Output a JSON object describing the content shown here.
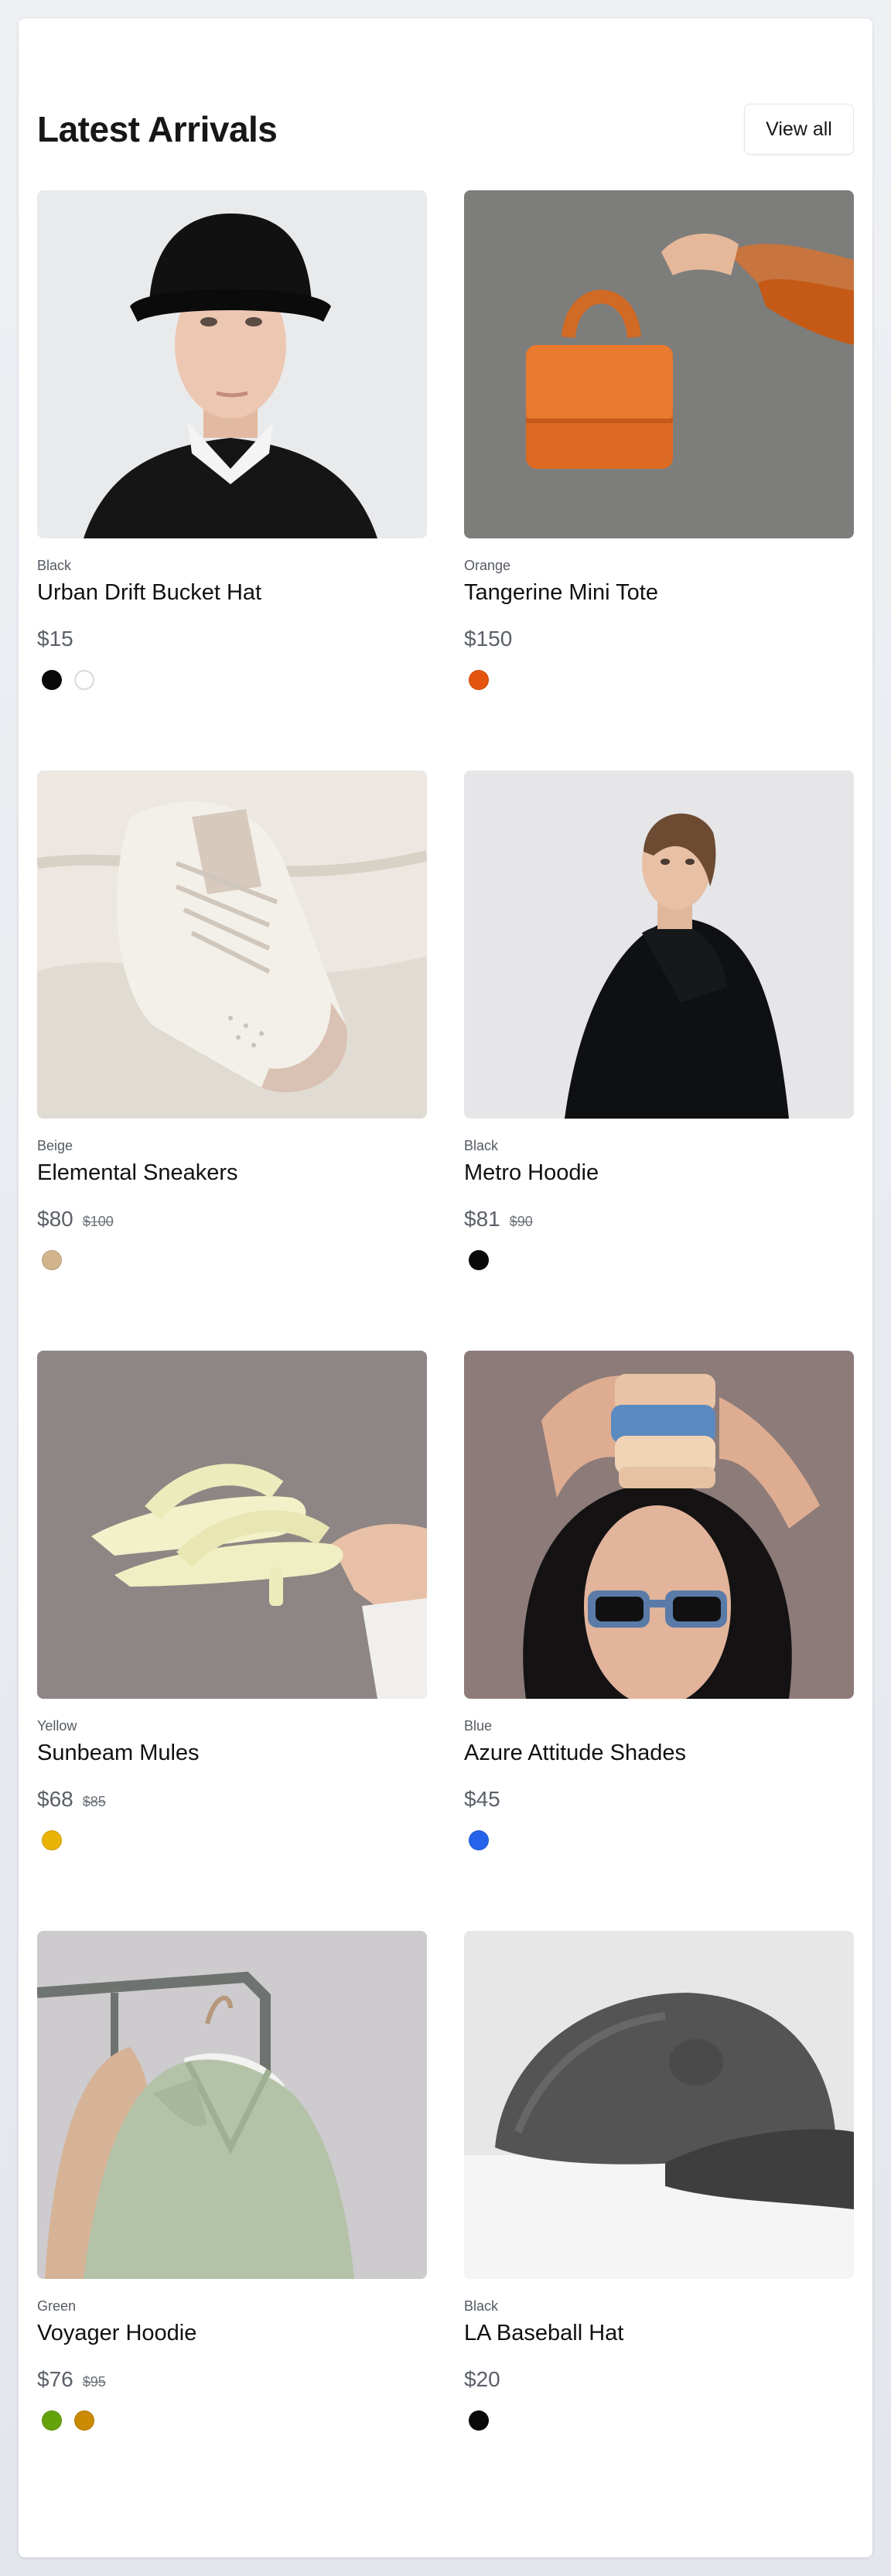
{
  "header": {
    "title": "Latest Arrivals",
    "view_all_label": "View all"
  },
  "products": [
    {
      "color_label": "Black",
      "name": "Urban Drift Bucket Hat",
      "price": "$15",
      "old_price": "",
      "swatches": [
        "#0a0a0a",
        "#ffffff"
      ]
    },
    {
      "color_label": "Orange",
      "name": "Tangerine Mini Tote",
      "price": "$150",
      "old_price": "",
      "swatches": [
        "#e4540f"
      ]
    },
    {
      "color_label": "Beige",
      "name": "Elemental Sneakers",
      "price": "$80",
      "old_price": "$100",
      "swatches": [
        "#d2b48c"
      ]
    },
    {
      "color_label": "Black",
      "name": "Metro Hoodie",
      "price": "$81",
      "old_price": "$90",
      "swatches": [
        "#0a0a0a"
      ]
    },
    {
      "color_label": "Yellow",
      "name": "Sunbeam Mules",
      "price": "$68",
      "old_price": "$85",
      "swatches": [
        "#eab308"
      ]
    },
    {
      "color_label": "Blue",
      "name": "Azure Attitude Shades",
      "price": "$45",
      "old_price": "",
      "swatches": [
        "#2563eb"
      ]
    },
    {
      "color_label": "Green",
      "name": "Voyager Hoodie",
      "price": "$76",
      "old_price": "$95",
      "swatches": [
        "#65a30d",
        "#ca8a04"
      ]
    },
    {
      "color_label": "Black",
      "name": "LA Baseball Hat",
      "price": "$20",
      "old_price": "",
      "swatches": [
        "#0a0a0a"
      ]
    }
  ]
}
